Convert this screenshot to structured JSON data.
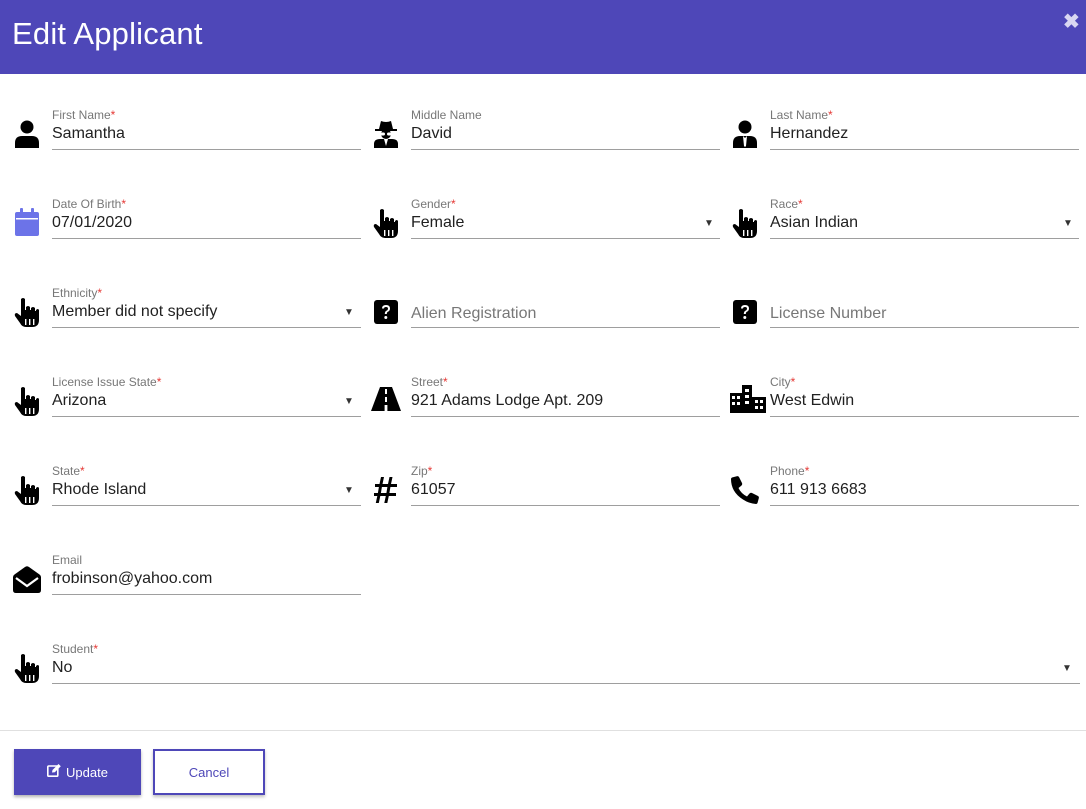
{
  "dialog": {
    "title": "Edit Applicant",
    "close_glyph": "✖"
  },
  "fields": {
    "first_name": {
      "label": "First Name",
      "required": "*",
      "value": "Samantha",
      "icon": "user-icon"
    },
    "middle_name": {
      "label": "Middle Name",
      "required": "",
      "value": "David",
      "icon": "user-secret-icon"
    },
    "last_name": {
      "label": "Last Name",
      "required": "*",
      "value": "Hernandez",
      "icon": "user-tie-icon"
    },
    "dob": {
      "label": "Date Of Birth",
      "required": "*",
      "value": "07/01/2020",
      "icon": "calendar-icon"
    },
    "gender": {
      "label": "Gender",
      "required": "*",
      "value": "Female",
      "icon": "hand-pointer-icon"
    },
    "race": {
      "label": "Race",
      "required": "*",
      "value": "Asian Indian",
      "icon": "hand-pointer-icon"
    },
    "ethnicity": {
      "label": "Ethnicity",
      "required": "*",
      "value": "Member did not specify",
      "icon": "hand-pointer-icon"
    },
    "alien_registration": {
      "placeholder": "Alien Registration",
      "icon": "question-square-icon"
    },
    "license_number": {
      "placeholder": "License Number",
      "icon": "question-square-icon"
    },
    "license_issue_state": {
      "label": "License Issue State",
      "required": "*",
      "value": "Arizona",
      "icon": "hand-pointer-icon"
    },
    "street": {
      "label": "Street",
      "required": "*",
      "value": "921 Adams Lodge Apt. 209",
      "icon": "road-icon"
    },
    "city": {
      "label": "City",
      "required": "*",
      "value": "West Edwin",
      "icon": "city-icon"
    },
    "state": {
      "label": "State",
      "required": "*",
      "value": "Rhode Island",
      "icon": "hand-pointer-icon"
    },
    "zip": {
      "label": "Zip",
      "required": "*",
      "value": "61057",
      "icon": "hashtag-icon"
    },
    "phone": {
      "label": "Phone",
      "required": "*",
      "value": "611 913 6683",
      "icon": "phone-icon"
    },
    "email": {
      "label": "Email",
      "required": "",
      "value": "frobinson@yahoo.com",
      "icon": "envelope-open-icon"
    },
    "student": {
      "label": "Student",
      "required": "*",
      "value": "No",
      "icon": "hand-pointer-icon"
    }
  },
  "caret_glyph": "▼",
  "actions": {
    "update_label": "Update",
    "cancel_label": "Cancel"
  },
  "colors": {
    "primary": "#4e47b8",
    "required": "#e53935",
    "calendar_icon": "#6c73e8"
  }
}
